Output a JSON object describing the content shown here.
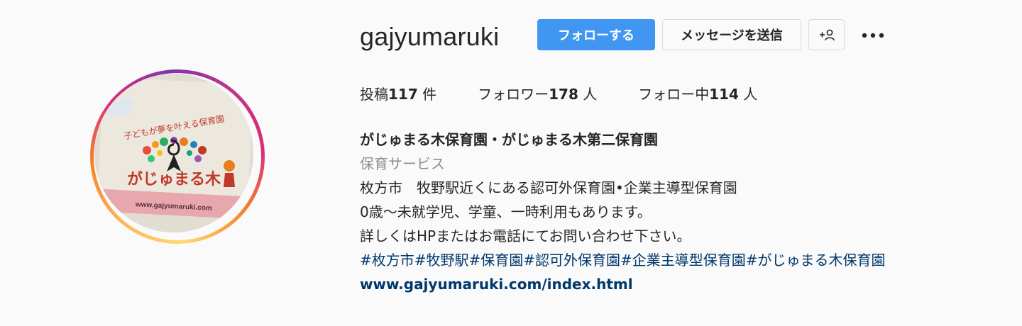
{
  "profile": {
    "username": "gajyumaruki",
    "avatar_logo_text": "がじゅまる木",
    "avatar_tagline": "子どもが夢を叶える保育園",
    "avatar_url_text": "www.gajyumaruki.com"
  },
  "actions": {
    "follow_label": "フォローする",
    "message_label": "メッセージを送信",
    "suggest_icon": "add-person-icon",
    "more_icon": "more-options-icon"
  },
  "stats": {
    "posts_label": "投稿",
    "posts_count": "117",
    "posts_unit": " 件",
    "followers_label": "フォロワー",
    "followers_count": "178",
    "followers_unit": " 人",
    "following_label": "フォロー中",
    "following_count": "114",
    "following_unit": " 人"
  },
  "bio": {
    "name": "がじゅまる木保育園・がじゅまる木第二保育園",
    "category": "保育サービス",
    "lines": [
      "枚方市　牧野駅近くにある認可外保育園•企業主導型保育園",
      "0歳〜未就学児、学童、一時利用もあります。",
      "詳しくはHPまたはお電話にてお問い合わせ下さい。"
    ],
    "hashtags": "#枚方市#牧野駅#保育園#認可外保育園#企業主導型保育園#がじゅまる木保育園",
    "website": "www.gajyumaruki.com/index.html"
  },
  "colors": {
    "follow_button": "#4096f0",
    "link": "#00376b",
    "muted": "#8e8e8e",
    "background": "#fafafa"
  }
}
